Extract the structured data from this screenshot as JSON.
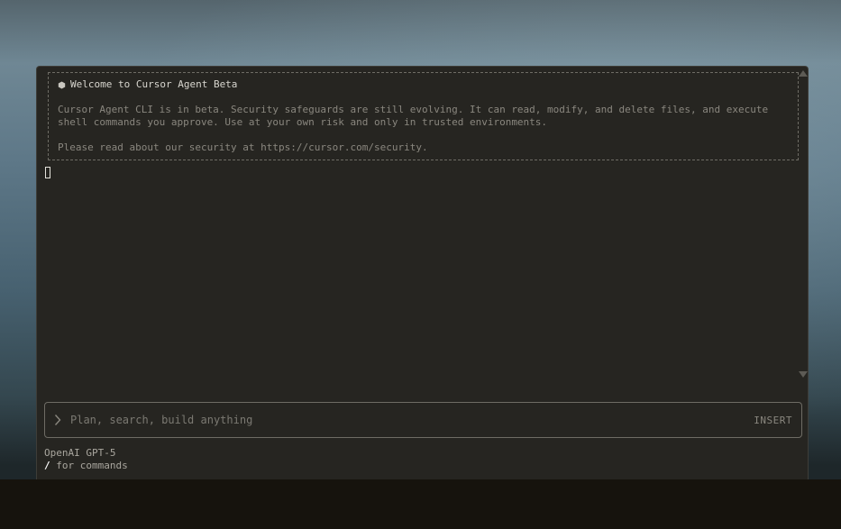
{
  "welcome": {
    "title": "Welcome to Cursor Agent Beta",
    "body": "Cursor Agent CLI is in beta. Security safeguards are still evolving. It can read, modify, and delete files, and execute\nshell commands you approve. Use at your own risk and only in trusted environments.",
    "security": "Please read about our security at https://cursor.com/security.",
    "icon": "hexagon-icon"
  },
  "prompt": {
    "placeholder": "Plan, search, build anything",
    "value": "",
    "mode": "INSERT",
    "icon": "chevron-right-icon"
  },
  "footer": {
    "model": "OpenAI GPT-5",
    "slash": "/",
    "hint": " for commands"
  },
  "colors": {
    "terminal_bg": "#262521",
    "text": "#d8d6cf",
    "muted": "#8a877f",
    "bottom_bar": "#16130d"
  }
}
